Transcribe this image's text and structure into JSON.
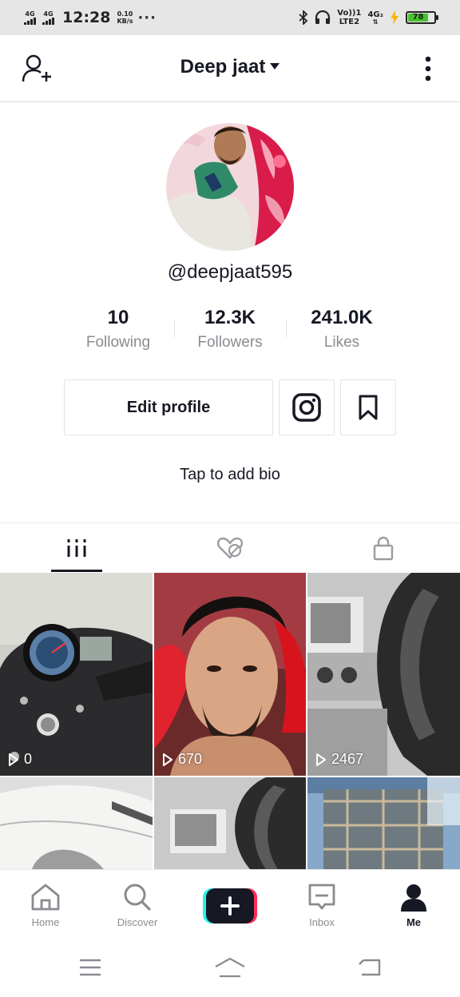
{
  "status_bar": {
    "sim1": "4G",
    "sim2": "4G",
    "time": "12:28",
    "speed_value": "0.10",
    "speed_unit": "KB/s",
    "overflow": "···",
    "volte_top": "Vo))1",
    "volte_bottom": "LTE2",
    "network_top": "4G₂",
    "battery": "78",
    "battery_level": 0.78,
    "battery_color": "#46c430"
  },
  "header": {
    "title": "Deep jaat",
    "left_icon": "add-user-icon",
    "right_icon": "more-vertical-icon"
  },
  "profile": {
    "username": "@deepjaat595",
    "stats": [
      {
        "value": "10",
        "label": "Following"
      },
      {
        "value": "12.3K",
        "label": "Followers"
      },
      {
        "value": "241.0K",
        "label": "Likes"
      }
    ],
    "edit_button": "Edit profile",
    "instagram_icon": "instagram-icon",
    "bookmark_icon": "bookmark-icon",
    "bio_prompt": "Tap to add bio"
  },
  "tabs": [
    {
      "icon": "videos-grid-icon",
      "active": true
    },
    {
      "icon": "liked-hidden-icon",
      "active": false
    },
    {
      "icon": "lock-icon",
      "active": false
    }
  ],
  "videos": [
    {
      "views": "0"
    },
    {
      "views": "670"
    },
    {
      "views": "2467"
    },
    {
      "views": ""
    },
    {
      "views": ""
    },
    {
      "views": ""
    }
  ],
  "bottom_nav": {
    "items": [
      {
        "label": "Home",
        "icon": "home-icon"
      },
      {
        "label": "Discover",
        "icon": "search-icon"
      },
      {
        "label": "",
        "icon": "plus-icon"
      },
      {
        "label": "Inbox",
        "icon": "inbox-icon"
      },
      {
        "label": "Me",
        "icon": "profile-icon"
      }
    ],
    "active": "Me"
  },
  "system_nav": [
    "menu-icon",
    "home-outline-icon",
    "back-icon"
  ],
  "colors": {
    "text_primary": "#161823",
    "text_secondary": "#8a8b91",
    "add_cyan": "#25f4ee",
    "add_red": "#fe2c55"
  }
}
